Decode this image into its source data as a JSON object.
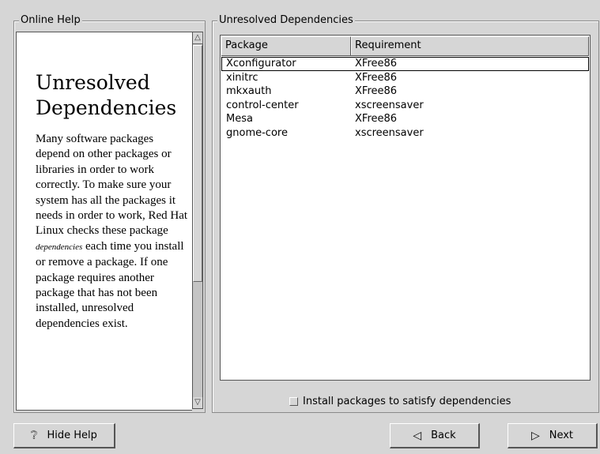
{
  "help_panel": {
    "frame_label": "Online Help",
    "title": "Unresolved Dependencies",
    "body_1": "Many software packages depend on other packages or libraries in order to work correctly. To make sure your system has all the packages it needs in order to work, Red Hat Linux checks these package ",
    "body_emph": "dependencies",
    "body_2": " each time you install or remove a package. If one package requires another package that has not been installed, unresolved dependencies exist."
  },
  "deps_panel": {
    "frame_label": "Unresolved Dependencies",
    "columns": [
      "Package",
      "Requirement"
    ],
    "rows": [
      {
        "package": "Xconfigurator",
        "requirement": "XFree86"
      },
      {
        "package": "xinitrc",
        "requirement": "XFree86"
      },
      {
        "package": "mkxauth",
        "requirement": "XFree86"
      },
      {
        "package": "control-center",
        "requirement": "xscreensaver"
      },
      {
        "package": "Mesa",
        "requirement": "XFree86"
      },
      {
        "package": "gnome-core",
        "requirement": "xscreensaver"
      }
    ],
    "checkbox_label": "Install packages to satisfy dependencies",
    "checkbox_checked": false
  },
  "buttons": {
    "hide_help": "Hide Help",
    "back": "Back",
    "next": "Next"
  },
  "icons": {
    "hide_help": "question-mark-icon",
    "back": "left-triangle-icon",
    "next": "right-triangle-icon"
  }
}
